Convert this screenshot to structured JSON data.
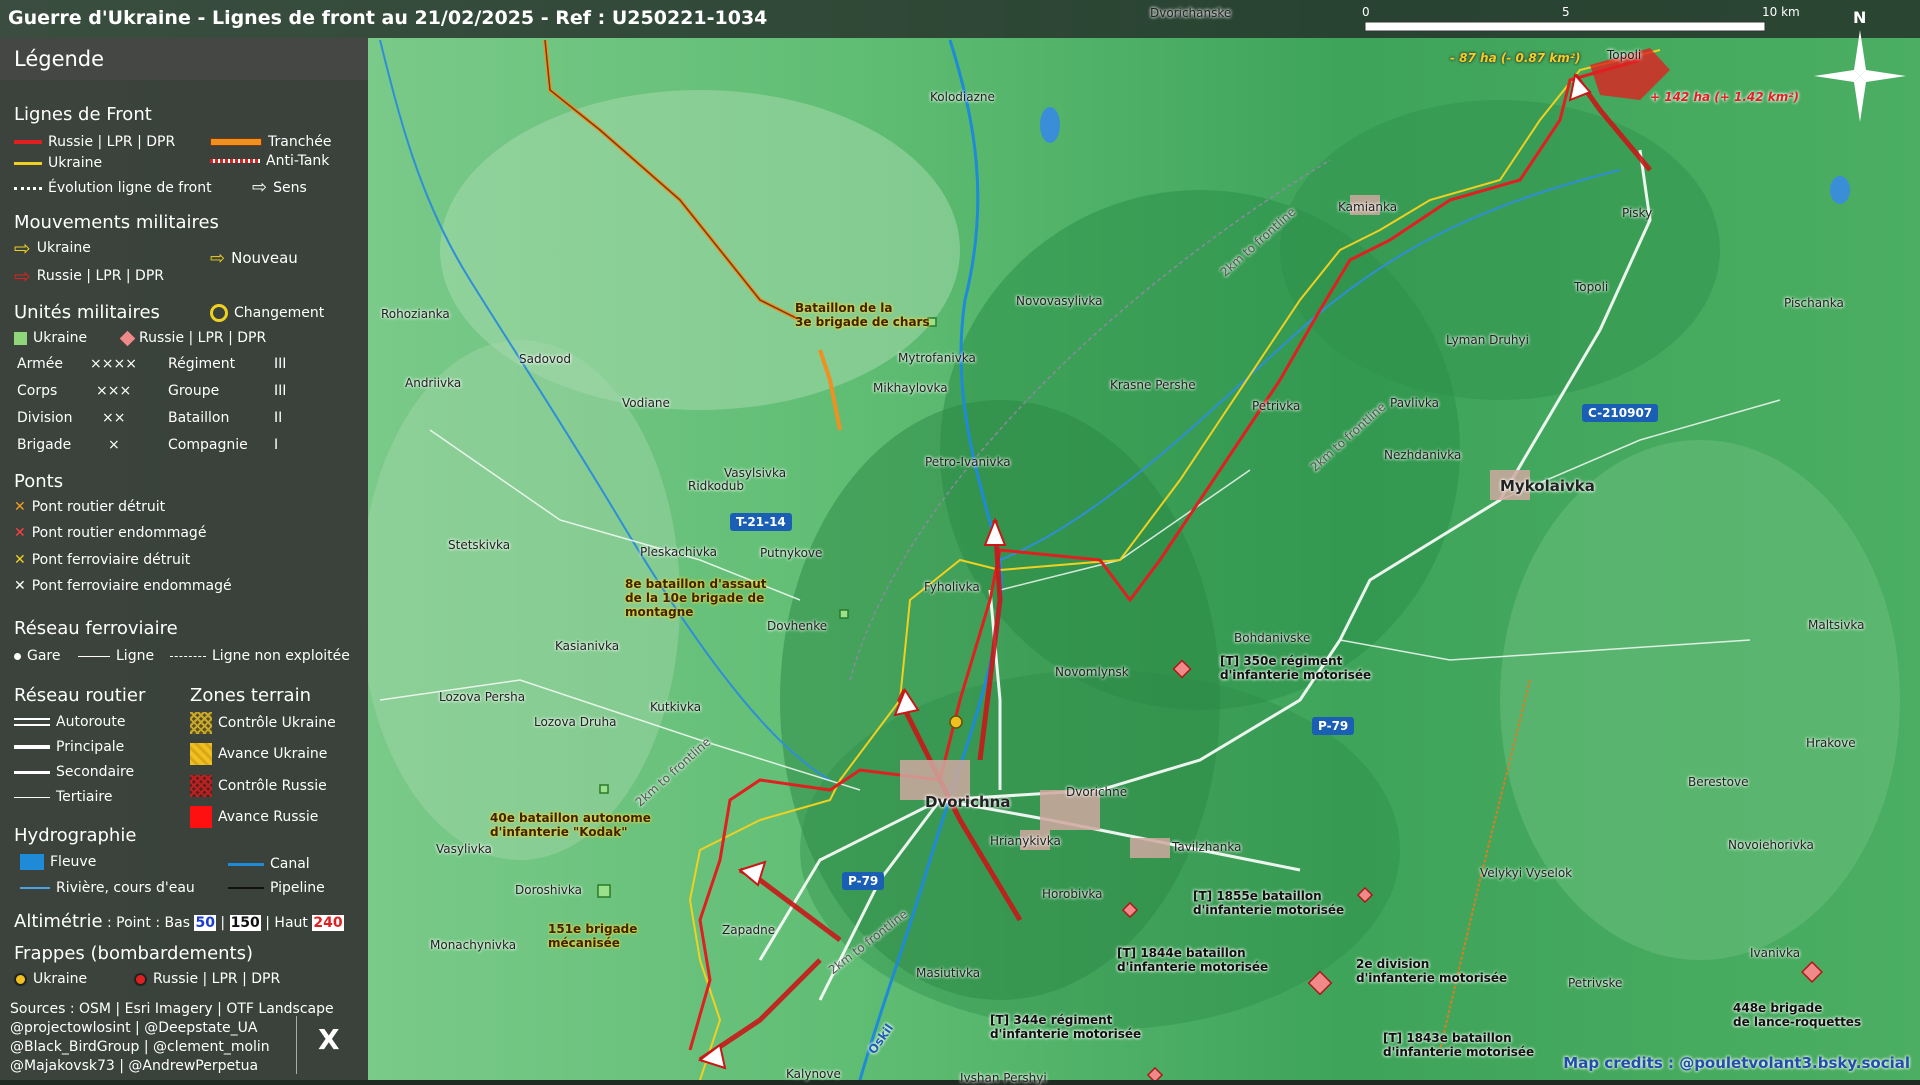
{
  "title": "Guerre d'Ukraine - Lignes de front au 21/02/2025 - Ref : U250221-1034",
  "scale": {
    "labels": [
      "0",
      "5",
      "10 km"
    ]
  },
  "north": "N",
  "legend": {
    "header": "Légende",
    "front": {
      "title": "Lignes de Front",
      "russia": "Russie | LPR | DPR",
      "ukraine": "Ukraine",
      "trench": "Tranchée",
      "antitank": "Anti-Tank",
      "evolution": "Évolution ligne de front",
      "sens": "Sens"
    },
    "moves": {
      "title": "Mouvements militaires",
      "ukraine": "Ukraine",
      "russia": "Russie | LPR | DPR",
      "nouveau": "Nouveau"
    },
    "units": {
      "title": "Unités militaires",
      "change": "Changement",
      "ukraine": "Ukraine",
      "russia": "Russie | LPR | DPR",
      "rows": [
        [
          "Armée",
          "××××",
          "Régiment",
          "III"
        ],
        [
          "Corps",
          "×××",
          "Groupe",
          "III"
        ],
        [
          "Division",
          "××",
          "Bataillon",
          "II"
        ],
        [
          "Brigade",
          "×",
          "Compagnie",
          "I"
        ]
      ]
    },
    "bridges": {
      "title": "Ponts",
      "items": [
        "Pont routier détruit",
        "Pont routier endommagé",
        "Pont ferroviaire détruit",
        "Pont ferroviaire endommagé"
      ]
    },
    "rail": {
      "title": "Réseau ferroviaire",
      "gare": "Gare",
      "ligne": "Ligne",
      "nonexp": "Ligne non exploitée"
    },
    "roads": {
      "title": "Réseau routier",
      "items": [
        "Autoroute",
        "Principale",
        "Secondaire",
        "Tertiaire"
      ]
    },
    "zones": {
      "title": "Zones terrain",
      "items": [
        "Contrôle Ukraine",
        "Avance Ukraine",
        "Contrôle Russie",
        "Avance Russie"
      ]
    },
    "hydro": {
      "title": "Hydrographie",
      "fleuve": "Fleuve",
      "canal": "Canal",
      "riviere": "Rivière, cours d'eau",
      "pipeline": "Pipeline"
    },
    "alti": {
      "title": "Altimétrie",
      "text": " : Point : Bas ",
      "low": "50",
      "mid": "150",
      "high": "240",
      "sep1": " | ",
      "sep2": " | Haut "
    },
    "strikes": {
      "title": "Frappes (bombardements)",
      "ukraine": "Ukraine",
      "russia": "Russie | LPR | DPR"
    },
    "sources": [
      "Sources : OSM | Esri Imagery | OTF Landscape",
      "@projectowlosint | @Deepstate_UA",
      "@Black_BirdGroup | @clement_molin",
      "@Majakovsk73 | @AndrewPerpetua"
    ],
    "x_icon": "X"
  },
  "places": [
    "Dvorichanske",
    "Kolodiazne",
    "Topoli",
    "Kamianka",
    "Pisky",
    "Topoli",
    "Pischanka",
    "Lyman Druhyi",
    "Novovasylivka",
    "Mytrofanivka",
    "Mikhaylovka",
    "Krasne Pershe",
    "Petrivka",
    "Pavlivka",
    "Nezhdanivka",
    "Mykolaivka",
    "Rohozianka",
    "Sadovod",
    "Andriivka",
    "Vodiane",
    "Vasylsivka",
    "Petro-Ivanivka",
    "Ridkodub",
    "Stetskivka",
    "Pleskachivka",
    "Putnykove",
    "Fyholivka",
    "Dovhenke",
    "Kasianivka",
    "Novomlynsk",
    "Bohdanivske",
    "Maltsivka",
    "Lozova Persha",
    "Kutkivka",
    "Lozova Druha",
    "Dvorichna",
    "Dvorichne",
    "Hrianykivka",
    "Tavilzhanka",
    "Vasylivka",
    "Doroshivka",
    "Horobivka",
    "Velykyi Vyselok",
    "Novoiehorivka",
    "Berestove",
    "Hrakove",
    "Monachynivka",
    "Zapadne",
    "Masiutivka",
    "Petrivske",
    "Ivanivka",
    "Kalynove",
    "Ivshan Pershyi"
  ],
  "roads": [
    "T-21-14",
    "P-79",
    "P-79",
    "C-210907"
  ],
  "labels_misc": [
    "2km to frontline",
    "2km to frontline",
    "2km to frontline",
    "2km to frontline",
    "Oskil"
  ],
  "units_ua": [
    "Bataillon de la\n3e brigade de chars",
    "8e bataillon d'assaut\nde la 10e brigade de\nmontagne",
    "40e bataillon autonome\nd'infanterie \"Kodak\"",
    "151e brigade\nmécanisée"
  ],
  "units_ru": [
    "[T] 350e régiment\nd'infanterie motorisée",
    "[T] 1855e bataillon\nd'infanterie motorisée",
    "[T] 1844e bataillon\nd'infanterie motorisée",
    "2e division\nd'infanterie motorisée",
    "[T] 344e régiment\nd'infanterie motorisée",
    "[T] 1843e bataillon\nd'infanterie motorisée",
    "448e brigade\nde lance-roquettes"
  ],
  "areas": {
    "loss": "- 87 ha (- 0.87 km²)",
    "gain": "+ 142 ha (+ 1.42 km²)"
  },
  "credits": "Map credits : @pouletvolant3.bsky.social",
  "colors": {
    "russia": "#e02020",
    "ukraine": "#f0d020",
    "river": "#1f8ad8",
    "legend_bg": "#343634"
  }
}
